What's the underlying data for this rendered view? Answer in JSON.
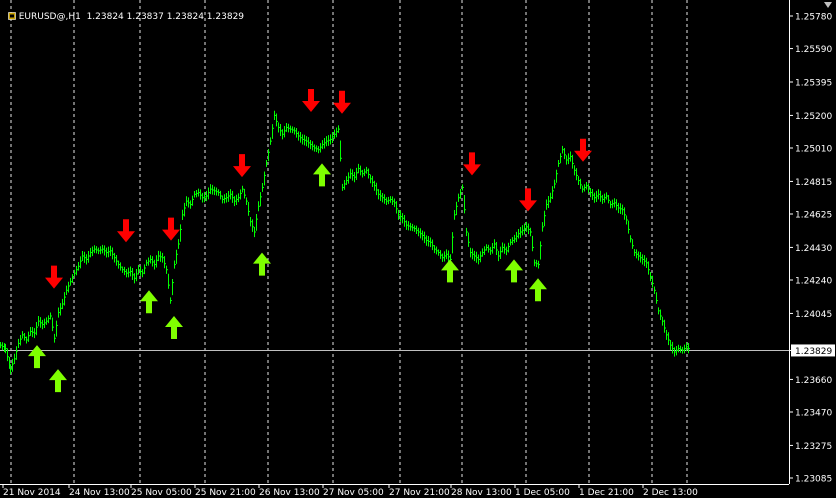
{
  "window": {
    "title": "EURUSD@,H1  1.23824 1.23837 1.23824 1.23829",
    "current_price": "1.23829"
  },
  "colors": {
    "background": "#000000",
    "candles": "#00ff00",
    "buy_arrow": "#7fff00",
    "sell_arrow": "#ff0000",
    "grid": "#ffffff",
    "price_line": "#c0c0c0"
  },
  "icons": [
    "chart-window-icon",
    "scroll-corner-icon"
  ],
  "chart_data": {
    "type": "candlestick",
    "symbol": "EURUSD@",
    "timeframe": "H1",
    "ylim": [
      1.2308,
      1.2578
    ],
    "y_ticks": [
      "1.25780",
      "1.25590",
      "1.25395",
      "1.25200",
      "1.25010",
      "1.24815",
      "1.24625",
      "1.24430",
      "1.24240",
      "1.24045",
      "1.23829",
      "1.23660",
      "1.23470",
      "1.23275",
      "1.23085"
    ],
    "y_tick_values": [
      1.2578,
      1.2559,
      1.25395,
      1.252,
      1.2501,
      1.24815,
      1.24625,
      1.2443,
      1.2424,
      1.24045,
      1.23829,
      1.2366,
      1.2347,
      1.23275,
      1.23085
    ],
    "x_ticks": [
      "21 Nov 2014",
      "24 Nov 13:00",
      "25 Nov 05:00",
      "25 Nov 21:00",
      "26 Nov 13:00",
      "27 Nov 05:00",
      "27 Nov 21:00",
      "28 Nov 13:00",
      "1 Dec 05:00",
      "1 Dec 21:00",
      "2 Dec 13:00"
    ],
    "grid": true,
    "points": [
      [
        0,
        1.2386
      ],
      [
        5,
        1.2384
      ],
      [
        10,
        1.2372
      ],
      [
        14,
        1.2378
      ],
      [
        18,
        1.2387
      ],
      [
        22,
        1.2392
      ],
      [
        26,
        1.2389
      ],
      [
        30,
        1.2394
      ],
      [
        34,
        1.2393
      ],
      [
        38,
        1.24
      ],
      [
        42,
        1.2398
      ],
      [
        46,
        1.24
      ],
      [
        50,
        1.2403
      ],
      [
        54,
        1.239
      ],
      [
        58,
        1.2405
      ],
      [
        62,
        1.241
      ],
      [
        66,
        1.2418
      ],
      [
        70,
        1.2423
      ],
      [
        74,
        1.2428
      ],
      [
        78,
        1.2432
      ],
      [
        82,
        1.2438
      ],
      [
        86,
        1.2436
      ],
      [
        90,
        1.244
      ],
      [
        94,
        1.2442
      ],
      [
        98,
        1.2441
      ],
      [
        102,
        1.2442
      ],
      [
        106,
        1.244
      ],
      [
        110,
        1.2441
      ],
      [
        114,
        1.2437
      ],
      [
        118,
        1.2433
      ],
      [
        122,
        1.243
      ],
      [
        126,
        1.2428
      ],
      [
        130,
        1.2429
      ],
      [
        134,
        1.2425
      ],
      [
        138,
        1.243
      ],
      [
        142,
        1.2428
      ],
      [
        146,
        1.2434
      ],
      [
        150,
        1.2436
      ],
      [
        154,
        1.2433
      ],
      [
        158,
        1.2438
      ],
      [
        162,
        1.2437
      ],
      [
        166,
        1.243
      ],
      [
        170,
        1.2412
      ],
      [
        174,
        1.2433
      ],
      [
        178,
        1.2445
      ],
      [
        182,
        1.2462
      ],
      [
        186,
        1.247
      ],
      [
        190,
        1.2468
      ],
      [
        194,
        1.2474
      ],
      [
        198,
        1.2475
      ],
      [
        202,
        1.2472
      ],
      [
        206,
        1.2473
      ],
      [
        210,
        1.2477
      ],
      [
        214,
        1.2476
      ],
      [
        218,
        1.2475
      ],
      [
        222,
        1.2471
      ],
      [
        226,
        1.2472
      ],
      [
        230,
        1.2474
      ],
      [
        234,
        1.247
      ],
      [
        238,
        1.2472
      ],
      [
        242,
        1.2477
      ],
      [
        246,
        1.247
      ],
      [
        250,
        1.2458
      ],
      [
        254,
        1.2452
      ],
      [
        258,
        1.2467
      ],
      [
        262,
        1.2478
      ],
      [
        266,
        1.2492
      ],
      [
        270,
        1.2505
      ],
      [
        274,
        1.252
      ],
      [
        278,
        1.2513
      ],
      [
        282,
        1.2509
      ],
      [
        286,
        1.2513
      ],
      [
        290,
        1.2512
      ],
      [
        294,
        1.2511
      ],
      [
        298,
        1.2508
      ],
      [
        302,
        1.2506
      ],
      [
        306,
        1.2505
      ],
      [
        310,
        1.2503
      ],
      [
        314,
        1.2501
      ],
      [
        318,
        1.25
      ],
      [
        322,
        1.2503
      ],
      [
        326,
        1.2505
      ],
      [
        330,
        1.2506
      ],
      [
        334,
        1.2509
      ],
      [
        338,
        1.2512
      ],
      [
        342,
        1.2478
      ],
      [
        346,
        1.2482
      ],
      [
        350,
        1.2486
      ],
      [
        354,
        1.2484
      ],
      [
        358,
        1.2489
      ],
      [
        362,
        1.2486
      ],
      [
        366,
        1.2488
      ],
      [
        370,
        1.2483
      ],
      [
        374,
        1.2479
      ],
      [
        378,
        1.2474
      ],
      [
        382,
        1.2472
      ],
      [
        386,
        1.247
      ],
      [
        390,
        1.2471
      ],
      [
        394,
        1.2469
      ],
      [
        398,
        1.2462
      ],
      [
        402,
        1.246
      ],
      [
        406,
        1.2456
      ],
      [
        410,
        1.2455
      ],
      [
        414,
        1.2454
      ],
      [
        418,
        1.2452
      ],
      [
        422,
        1.245
      ],
      [
        426,
        1.2447
      ],
      [
        430,
        1.2446
      ],
      [
        434,
        1.2442
      ],
      [
        438,
        1.244
      ],
      [
        442,
        1.2437
      ],
      [
        446,
        1.2439
      ],
      [
        450,
        1.2436
      ],
      [
        454,
        1.2462
      ],
      [
        458,
        1.2472
      ],
      [
        462,
        1.2478
      ],
      [
        466,
        1.2452
      ],
      [
        470,
        1.244
      ],
      [
        474,
        1.2438
      ],
      [
        478,
        1.2436
      ],
      [
        482,
        1.244
      ],
      [
        486,
        1.2443
      ],
      [
        490,
        1.2441
      ],
      [
        494,
        1.2445
      ],
      [
        498,
        1.2438
      ],
      [
        502,
        1.2443
      ],
      [
        506,
        1.2441
      ],
      [
        510,
        1.2446
      ],
      [
        514,
        1.2448
      ],
      [
        518,
        1.2451
      ],
      [
        522,
        1.2453
      ],
      [
        526,
        1.2455
      ],
      [
        530,
        1.2452
      ],
      [
        534,
        1.2434
      ],
      [
        538,
        1.2433
      ],
      [
        542,
        1.2455
      ],
      [
        546,
        1.2468
      ],
      [
        550,
        1.2472
      ],
      [
        554,
        1.248
      ],
      [
        558,
        1.2492
      ],
      [
        562,
        1.25
      ],
      [
        566,
        1.2494
      ],
      [
        570,
        1.2496
      ],
      [
        574,
        1.2488
      ],
      [
        578,
        1.2482
      ],
      [
        582,
        1.2477
      ],
      [
        586,
        1.2479
      ],
      [
        590,
        1.2475
      ],
      [
        594,
        1.2472
      ],
      [
        598,
        1.2474
      ],
      [
        602,
        1.2471
      ],
      [
        606,
        1.2473
      ],
      [
        610,
        1.2468
      ],
      [
        614,
        1.2469
      ],
      [
        618,
        1.2466
      ],
      [
        622,
        1.2465
      ],
      [
        626,
        1.2459
      ],
      [
        630,
        1.2448
      ],
      [
        634,
        1.244
      ],
      [
        638,
        1.2438
      ],
      [
        642,
        1.2436
      ],
      [
        646,
        1.2434
      ],
      [
        650,
        1.2426
      ],
      [
        654,
        1.2418
      ],
      [
        658,
        1.2406
      ],
      [
        662,
        1.24
      ],
      [
        666,
        1.2392
      ],
      [
        670,
        1.2386
      ],
      [
        674,
        1.2382
      ],
      [
        678,
        1.2384
      ],
      [
        682,
        1.2383
      ],
      [
        686,
        1.2385
      ],
      [
        690,
        1.2383
      ]
    ],
    "buy_signals": [
      [
        37,
        1.2386
      ],
      [
        58,
        1.2372
      ],
      [
        149,
        1.2418
      ],
      [
        174,
        1.2403
      ],
      [
        262,
        1.244
      ],
      [
        322,
        1.2492
      ],
      [
        450,
        1.2436
      ],
      [
        514,
        1.2436
      ],
      [
        538,
        1.2425
      ]
    ],
    "sell_signals": [
      [
        54,
        1.2419
      ],
      [
        126,
        1.2446
      ],
      [
        171,
        1.2447
      ],
      [
        242,
        1.2484
      ],
      [
        311,
        1.2522
      ],
      [
        342,
        1.2521
      ],
      [
        472,
        1.2485
      ],
      [
        528,
        1.2464
      ],
      [
        583,
        1.2493
      ]
    ]
  }
}
